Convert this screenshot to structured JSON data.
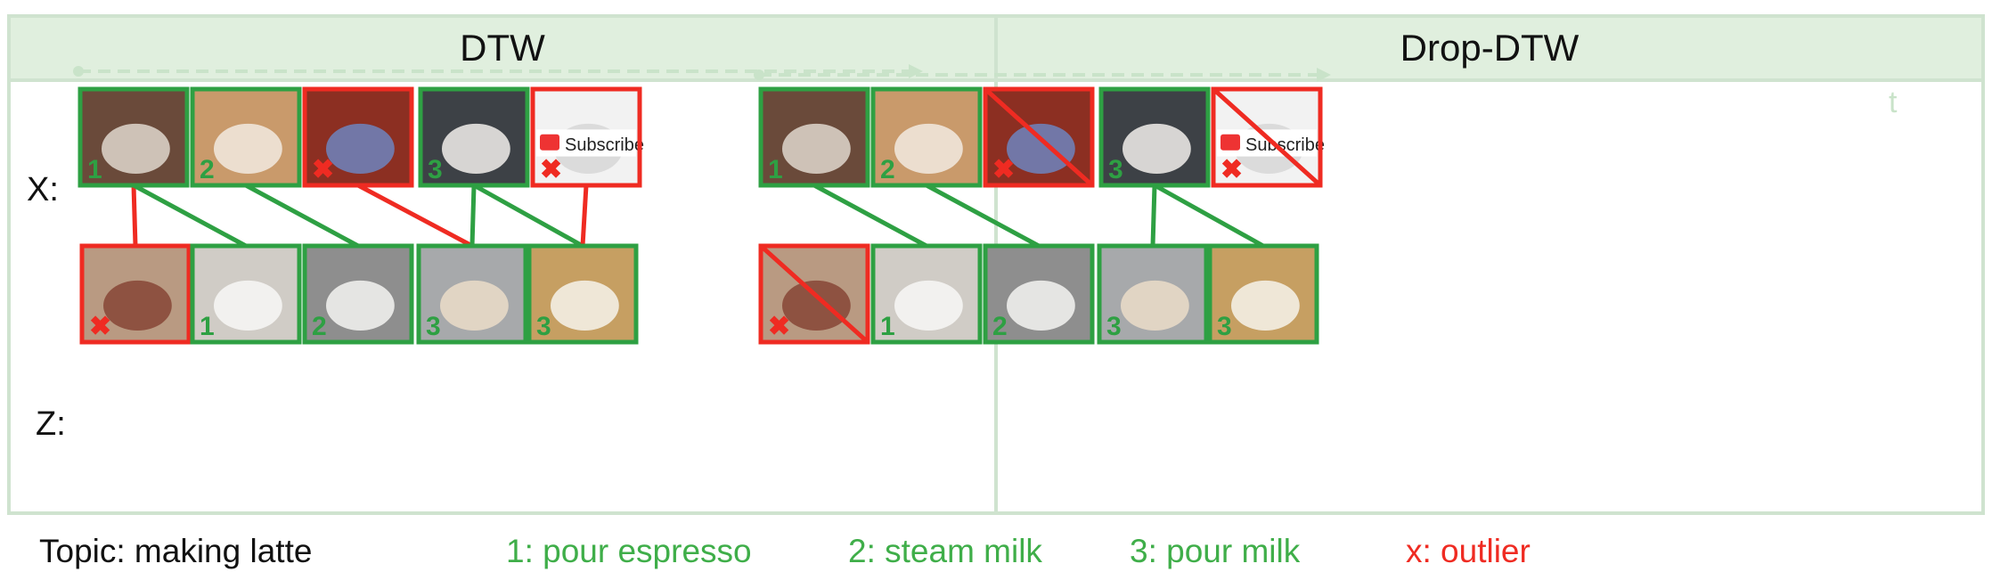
{
  "panels": [
    {
      "title": "DTW",
      "kind": "dtw"
    },
    {
      "title": "Drop-DTW",
      "kind": "dropdtw"
    }
  ],
  "row_labels": {
    "x": "X:",
    "z": "Z:"
  },
  "time_label": "t",
  "colors": {
    "match": "#2ea043",
    "outlier": "#ef2b22",
    "faint": "#c9e3c9"
  },
  "x_frames": [
    {
      "id": "espresso_machine",
      "label": "1",
      "kind": "step"
    },
    {
      "id": "latte_art_pour",
      "label": "2",
      "kind": "step"
    },
    {
      "id": "presenter",
      "label": "x",
      "kind": "outlier"
    },
    {
      "id": "steamed_milk",
      "label": "3",
      "kind": "step"
    },
    {
      "id": "subscribe_screen",
      "label": "x",
      "kind": "outlier",
      "text": "Subscribe"
    }
  ],
  "z_frames": [
    {
      "id": "man_drinking",
      "label": "x",
      "kind": "outlier"
    },
    {
      "id": "cup_under_machine",
      "label": "1",
      "kind": "step"
    },
    {
      "id": "steaming_wand",
      "label": "2",
      "kind": "step"
    },
    {
      "id": "pitcher_pour",
      "label": "3",
      "kind": "step"
    },
    {
      "id": "pour_into_cup",
      "label": "3",
      "kind": "step"
    }
  ],
  "dtw_links": [
    {
      "x": 1,
      "z": 1,
      "type": "outlier"
    },
    {
      "x": 1,
      "z": 2,
      "type": "match"
    },
    {
      "x": 2,
      "z": 3,
      "type": "match"
    },
    {
      "x": 3,
      "z": 4,
      "type": "outlier"
    },
    {
      "x": 4,
      "z": 4,
      "type": "match"
    },
    {
      "x": 4,
      "z": 5,
      "type": "match"
    },
    {
      "x": 5,
      "z": 5,
      "type": "outlier"
    }
  ],
  "dropdtw_links": [
    {
      "x": 1,
      "z": 2,
      "type": "match"
    },
    {
      "x": 2,
      "z": 3,
      "type": "match"
    },
    {
      "x": 4,
      "z": 4,
      "type": "match"
    },
    {
      "x": 4,
      "z": 5,
      "type": "match"
    }
  ],
  "legend": {
    "topic": "Topic: making latte",
    "step1": "1: pour espresso",
    "step2": "2: steam milk",
    "step3": "3: pour milk",
    "outlier": "x: outlier"
  }
}
